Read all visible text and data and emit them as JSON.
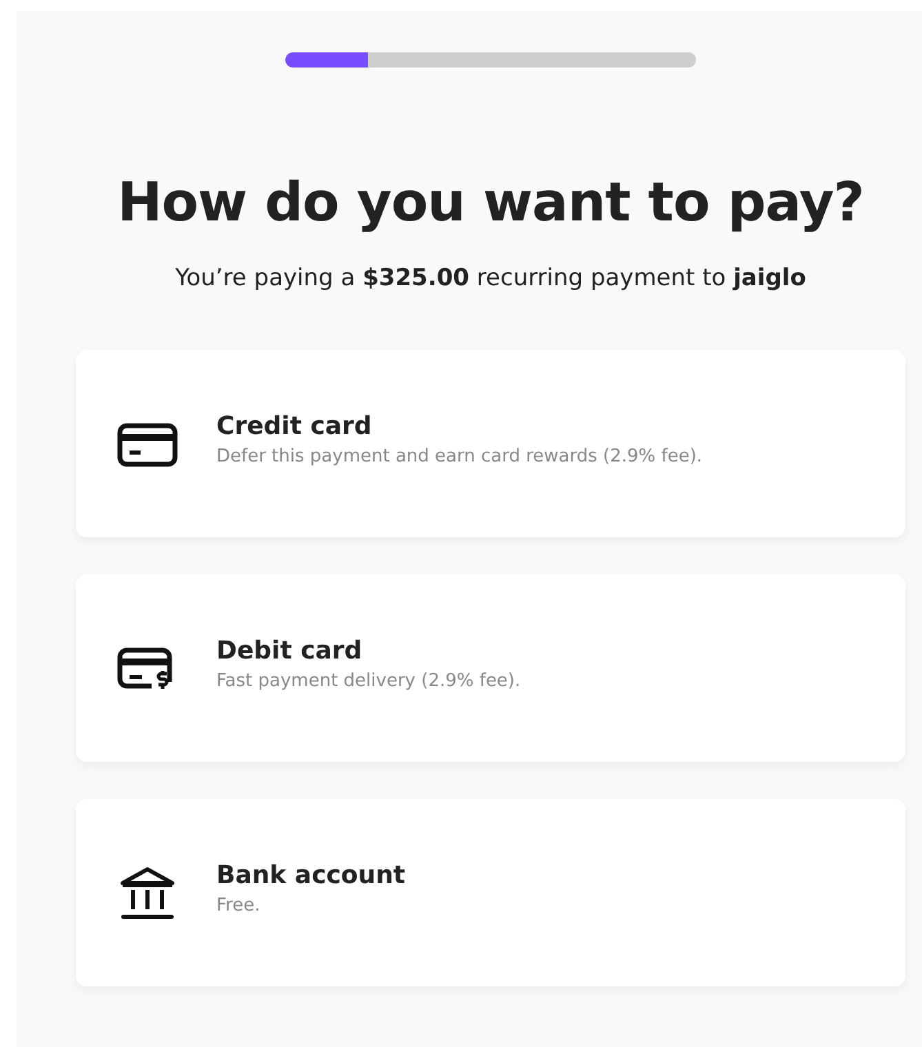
{
  "progress": {
    "level": 0.2
  },
  "title": "How do you want to pay?",
  "subtitle": "You’re paying a **$325.00** recurring payment to **jaiglo**",
  "options": [
    {
      "kind": "credit",
      "title": "Credit card",
      "description": "Defer this payment and earn card rewards (2.9% fee)."
    },
    {
      "kind": "debit",
      "title": "Debit card",
      "description": "Fast payment delivery (2.9% fee)."
    },
    {
      "kind": "bank",
      "title": "Bank account",
      "description": "Free."
    }
  ]
}
